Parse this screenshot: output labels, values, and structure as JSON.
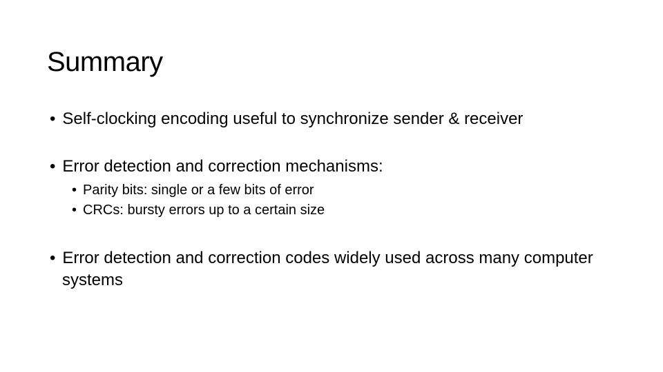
{
  "slide": {
    "title": "Summary",
    "bullets": {
      "b1": "Self-clocking encoding useful to synchronize sender & receiver",
      "b2": "Error detection and correction mechanisms:",
      "b2_sub1": "Parity bits: single or a few bits of error",
      "b2_sub2": "CRCs: bursty errors up to a certain size",
      "b3": "Error detection and correction codes widely used across many computer systems"
    }
  }
}
